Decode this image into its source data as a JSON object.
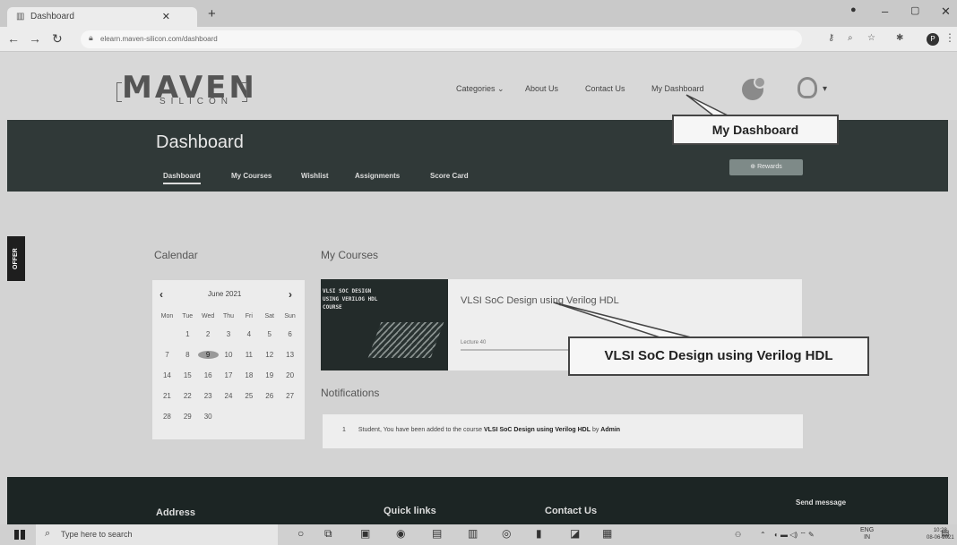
{
  "browser": {
    "tab_title": "Dashboard",
    "url": "elearn.maven-silicon.com/dashboard",
    "profile_initial": "P"
  },
  "site": {
    "logo_text": "MAVEN",
    "logo_sub": "SILICON",
    "menu": [
      "Categories ⌄",
      "About Us",
      "Contact Us",
      "My Dashboard"
    ],
    "page_title": "Dashboard",
    "tabs": [
      "Dashboard",
      "My Courses",
      "Wishlist",
      "Assignments",
      "Score Card"
    ],
    "rewards_label": "Rewards",
    "offer_label": "OFFER"
  },
  "calendar": {
    "title": "Calendar",
    "month": "June 2021",
    "weekdays": [
      "Mon",
      "Tue",
      "Wed",
      "Thu",
      "Fri",
      "Sat",
      "Sun"
    ],
    "weeks": [
      [
        "",
        "1",
        "2",
        "3",
        "4",
        "5",
        "6"
      ],
      [
        "7",
        "8",
        "9",
        "10",
        "11",
        "12",
        "13"
      ],
      [
        "14",
        "15",
        "16",
        "17",
        "18",
        "19",
        "20"
      ],
      [
        "21",
        "22",
        "23",
        "24",
        "25",
        "26",
        "27"
      ],
      [
        "28",
        "29",
        "30",
        "",
        "",
        "",
        ""
      ]
    ],
    "today": "9"
  },
  "courses": {
    "title": "My Courses",
    "items": [
      {
        "name": "VLSI SoC Design using Verilog HDL",
        "lecture": "Lecture 40",
        "thumb_lines": [
          "VLSI SOC DESIGN",
          "USING VERILOG HDL",
          "COURSE"
        ]
      }
    ]
  },
  "notifications": {
    "title": "Notifications",
    "items": [
      {
        "index": "1",
        "prefix": "Student, You have been added to the course ",
        "course": "VLSI SoC Design using Verilog HDL",
        "by": " by ",
        "admin": "Admin"
      }
    ]
  },
  "callouts": {
    "dashboard": "My Dashboard",
    "course": "VLSI SoC Design using Verilog HDL"
  },
  "footer": {
    "address": "Address",
    "quick_links": "Quick links",
    "contact": "Contact Us",
    "send": "Send message"
  },
  "taskbar": {
    "search_placeholder": "Type here to search",
    "lang": "ENG",
    "region": "IN",
    "time": "10:28",
    "date": "08-06-2021"
  }
}
